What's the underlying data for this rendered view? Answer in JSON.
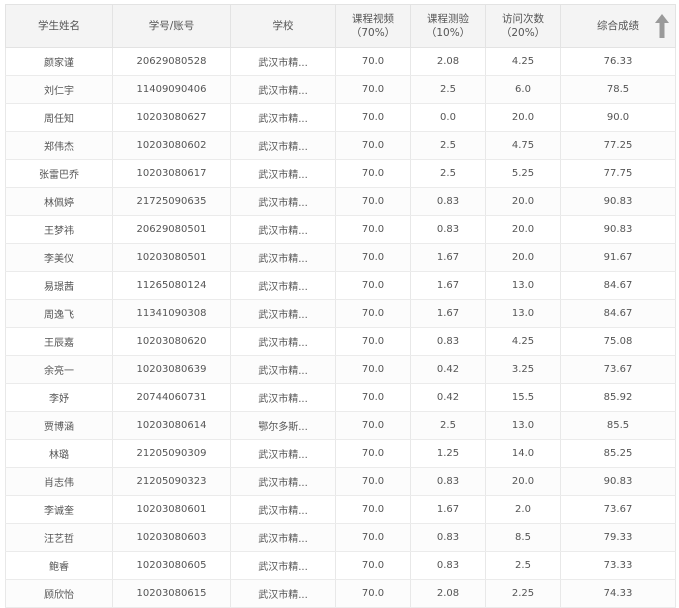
{
  "table": {
    "headers": {
      "name": "学生姓名",
      "id": "学号/账号",
      "school": "学校",
      "video": "课程视频",
      "video_pct": "（70%）",
      "quiz": "课程测验",
      "quiz_pct": "（10%）",
      "visit": "访问次数",
      "visit_pct": "（20%）",
      "total": "综合成绩"
    },
    "sort_icon": "arrow-up-icon",
    "rows": [
      {
        "name": "颜家谨",
        "id": "20629080528",
        "school": "武汉市精...",
        "video": "70.0",
        "quiz": "2.08",
        "visit": "4.25",
        "total": "76.33"
      },
      {
        "name": "刘仁宇",
        "id": "11409090406",
        "school": "武汉市精...",
        "video": "70.0",
        "quiz": "2.5",
        "visit": "6.0",
        "total": "78.5"
      },
      {
        "name": "周任知",
        "id": "10203080627",
        "school": "武汉市精...",
        "video": "70.0",
        "quiz": "0.0",
        "visit": "20.0",
        "total": "90.0"
      },
      {
        "name": "郑伟杰",
        "id": "10203080602",
        "school": "武汉市精...",
        "video": "70.0",
        "quiz": "2.5",
        "visit": "4.75",
        "total": "77.25"
      },
      {
        "name": "张雷巴乔",
        "id": "10203080617",
        "school": "武汉市精...",
        "video": "70.0",
        "quiz": "2.5",
        "visit": "5.25",
        "total": "77.75"
      },
      {
        "name": "林佩婷",
        "id": "21725090635",
        "school": "武汉市精...",
        "video": "70.0",
        "quiz": "0.83",
        "visit": "20.0",
        "total": "90.83"
      },
      {
        "name": "王梦祎",
        "id": "20629080501",
        "school": "武汉市精...",
        "video": "70.0",
        "quiz": "0.83",
        "visit": "20.0",
        "total": "90.83"
      },
      {
        "name": "李美仪",
        "id": "10203080501",
        "school": "武汉市精...",
        "video": "70.0",
        "quiz": "1.67",
        "visit": "20.0",
        "total": "91.67"
      },
      {
        "name": "易璟茜",
        "id": "11265080124",
        "school": "武汉市精...",
        "video": "70.0",
        "quiz": "1.67",
        "visit": "13.0",
        "total": "84.67"
      },
      {
        "name": "周逸飞",
        "id": "11341090308",
        "school": "武汉市精...",
        "video": "70.0",
        "quiz": "1.67",
        "visit": "13.0",
        "total": "84.67"
      },
      {
        "name": "王辰嘉",
        "id": "10203080620",
        "school": "武汉市精...",
        "video": "70.0",
        "quiz": "0.83",
        "visit": "4.25",
        "total": "75.08"
      },
      {
        "name": "余亮一",
        "id": "10203080639",
        "school": "武汉市精...",
        "video": "70.0",
        "quiz": "0.42",
        "visit": "3.25",
        "total": "73.67"
      },
      {
        "name": "李妤",
        "id": "20744060731",
        "school": "武汉市精...",
        "video": "70.0",
        "quiz": "0.42",
        "visit": "15.5",
        "total": "85.92"
      },
      {
        "name": "贾博涵",
        "id": "10203080614",
        "school": "鄂尔多斯...",
        "video": "70.0",
        "quiz": "2.5",
        "visit": "13.0",
        "total": "85.5"
      },
      {
        "name": "林璐",
        "id": "21205090309",
        "school": "武汉市精...",
        "video": "70.0",
        "quiz": "1.25",
        "visit": "14.0",
        "total": "85.25"
      },
      {
        "name": "肖志伟",
        "id": "21205090323",
        "school": "武汉市精...",
        "video": "70.0",
        "quiz": "0.83",
        "visit": "20.0",
        "total": "90.83"
      },
      {
        "name": "李诚奎",
        "id": "10203080601",
        "school": "武汉市精...",
        "video": "70.0",
        "quiz": "1.67",
        "visit": "2.0",
        "total": "73.67"
      },
      {
        "name": "汪艺哲",
        "id": "10203080603",
        "school": "武汉市精...",
        "video": "70.0",
        "quiz": "0.83",
        "visit": "8.5",
        "total": "79.33"
      },
      {
        "name": "鲍睿",
        "id": "10203080605",
        "school": "武汉市精...",
        "video": "70.0",
        "quiz": "0.83",
        "visit": "2.5",
        "total": "73.33"
      },
      {
        "name": "顾欣怡",
        "id": "10203080615",
        "school": "武汉市精...",
        "video": "70.0",
        "quiz": "2.08",
        "visit": "2.25",
        "total": "74.33"
      }
    ]
  }
}
